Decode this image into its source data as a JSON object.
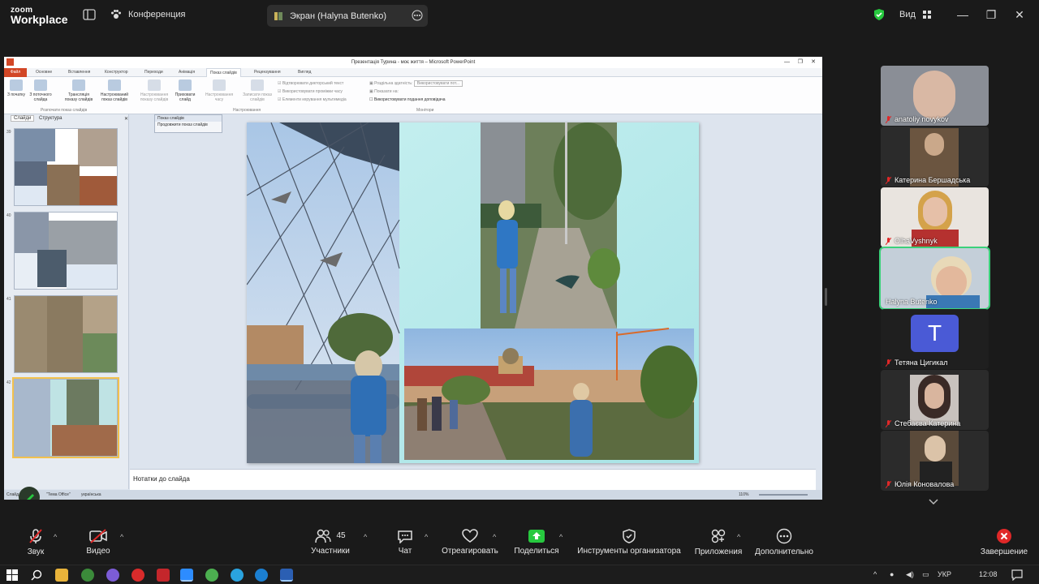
{
  "app": {
    "logo_small": "zoom",
    "logo_big": "Workplace",
    "meeting_label": "Конференция",
    "share_label": "Экран (Halyna Butenko)",
    "view_label": "Вид"
  },
  "ppt": {
    "title": "Презентація Турина - моє життя  –  Microsoft PowerPoint",
    "file_tab": "Файл",
    "tabs": [
      "Основне",
      "Вставлення",
      "Конструктор",
      "Переходи",
      "Анімація",
      "Показ слайдів",
      "Рецензування",
      "Вигляд"
    ],
    "active_tab": "Показ слайдів",
    "ribbon_buttons": [
      "З початку",
      "З поточного слайда",
      "Трансляція показу слайдів",
      "Настроюваний показ слайдів",
      "Настроювання показу слайдів",
      "Приховати слайд",
      "Настроювання часу",
      "Записати показ слайдів"
    ],
    "ribbon_checks": [
      "Відтворювати дикторський текст",
      "Використовувати проміжки часу",
      "Елементи керування мультимедіа",
      "Роздільна здатність:",
      "Показати на:",
      "Використовувати подання доповідача"
    ],
    "resolution_value": "Використовувати пот...",
    "group_labels": [
      "Розпочати показ слайдів",
      "Настроювання",
      "Монітори"
    ],
    "pane_tabs": [
      "Слайди",
      "Структура"
    ],
    "slide_numbers": [
      "39",
      "40",
      "41",
      "42"
    ],
    "popup_title": "Показ слайдів",
    "popup_item": "Продовжити показ слайдів",
    "notes_placeholder": "Нотатки до слайда",
    "status_left": "Слайд",
    "status_theme": "\"Тема Office\"",
    "status_lang": "українська",
    "zoom_level": "110%"
  },
  "participants": [
    {
      "name": "anatoliy novykov",
      "bg": "#8a8e96"
    },
    {
      "name": "Катерина Бершадська",
      "bg": "#6b5540"
    },
    {
      "name": "OlhaVyshnyk",
      "bg": "#c9a58a"
    },
    {
      "name": "Halyna Butenko",
      "bg": "#9bb2c9",
      "active": true
    },
    {
      "name": "Тетяна Цигикал",
      "bg": "#2b2b2b",
      "initial": "T"
    },
    {
      "name": "Стебаєва Катерина",
      "bg": "#9a8f8a"
    },
    {
      "name": "Юлія Коновалова",
      "bg": "#8a7a6a"
    }
  ],
  "toolbar": {
    "audio": "Звук",
    "video": "Видео",
    "participants": "Участники",
    "participants_count": "45",
    "chat": "Чат",
    "react": "Отреагировать",
    "share": "Поделиться",
    "host_tools": "Инструменты организатора",
    "apps": "Приложения",
    "more": "Дополнительно",
    "end": "Завершение"
  },
  "taskbar": {
    "lang": "УКР",
    "time": "12:08"
  },
  "colors": {
    "share_green": "#27c93f",
    "end_red": "#e02828",
    "mic_off_red": "#e02828",
    "active_border": "#3bd17a",
    "ppt_orange": "#d24726"
  }
}
